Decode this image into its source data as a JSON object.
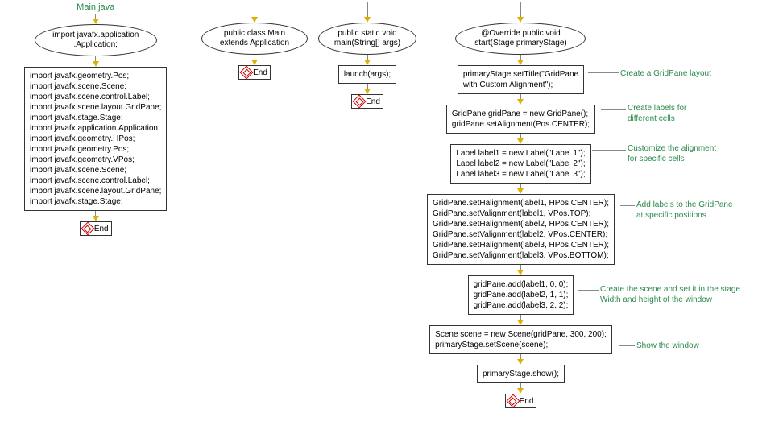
{
  "title": "Main.java",
  "col1": {
    "ellipse": "import javafx.application\n.Application;",
    "rect": "import javafx.geometry.Pos;\nimport javafx.scene.Scene;\nimport javafx.scene.control.Label;\nimport javafx.scene.layout.GridPane;\nimport javafx.stage.Stage;\nimport javafx.application.Application;\nimport javafx.geometry.HPos;\nimport javafx.geometry.Pos;\nimport javafx.geometry.VPos;\nimport javafx.scene.Scene;\nimport javafx.scene.control.Label;\nimport javafx.scene.layout.GridPane;\nimport javafx.stage.Stage;",
    "end": "End"
  },
  "col2": {
    "ellipse": "public class Main\nextends Application",
    "end": "End"
  },
  "col3": {
    "ellipse": "public static void\nmain(String[] args)",
    "rect": "launch(args);",
    "end": "End"
  },
  "col4": {
    "ellipse": "@Override public void\nstart(Stage primaryStage)",
    "rect1": "primaryStage.setTitle(\"GridPane\nwith Custom Alignment\");",
    "rect2": "GridPane gridPane = new GridPane();\ngridPane.setAlignment(Pos.CENTER);",
    "rect3": "Label label1 = new Label(\"Label 1\");\nLabel label2 = new Label(\"Label 2\");\nLabel label3 = new Label(\"Label 3\");",
    "rect4": "GridPane.setHalignment(label1, HPos.CENTER);\nGridPane.setValignment(label1, VPos.TOP);\nGridPane.setHalignment(label2, HPos.CENTER);\nGridPane.setValignment(label2, VPos.CENTER);\nGridPane.setHalignment(label3, HPos.CENTER);\nGridPane.setValignment(label3, VPos.BOTTOM);",
    "rect5": "gridPane.add(label1, 0, 0);\ngridPane.add(label2, 1, 1);\ngridPane.add(label3, 2, 2);",
    "rect6": "Scene scene = new Scene(gridPane, 300, 200);\nprimaryStage.setScene(scene);",
    "rect7": "primaryStage.show();",
    "end": "End"
  },
  "annotations": {
    "a1": "Create a GridPane layout",
    "a2": "Create labels for\ndifferent cells",
    "a3": "Customize the alignment\nfor specific cells",
    "a4": "Add labels to the GridPane\nat specific positions",
    "a5": "Create the scene and set it in the stage\nWidth and height of the window",
    "a6": "Show the window"
  }
}
